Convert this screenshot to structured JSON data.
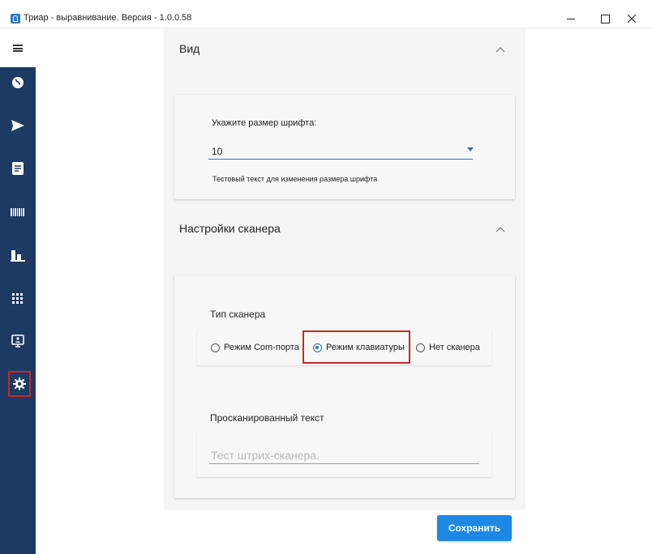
{
  "window": {
    "title": "Триар - выравнивание. Версия - 1.0.0.58"
  },
  "sidebar": {
    "items": [
      {
        "icon": "globe-icon"
      },
      {
        "icon": "send-icon"
      },
      {
        "icon": "document-icon"
      },
      {
        "icon": "barcode-icon"
      },
      {
        "icon": "bar-chart-icon"
      },
      {
        "icon": "grid-icon"
      },
      {
        "icon": "presentation-icon"
      },
      {
        "icon": "gear-icon",
        "active": true
      }
    ]
  },
  "view_section": {
    "title": "Вид",
    "font_size_label": "Укажите размер шрифта:",
    "font_size_value": "10",
    "sample_text": "Тестовый текст для изменения размера шрифта"
  },
  "scanner_section": {
    "title": "Настройки сканера",
    "scanner_type_label": "Тип сканера",
    "options": [
      {
        "label": "Режим Com-порта",
        "checked": false
      },
      {
        "label": "Режим клавиатуры",
        "checked": true
      },
      {
        "label": "Нет сканера",
        "checked": false
      }
    ],
    "scanned_text_label": "Просканированный текст",
    "scanned_text_placeholder": "Тест штрих-сканера."
  },
  "save_label": "Сохранить",
  "colors": {
    "sidebar": "#1d3a63",
    "accent": "#1e88e5",
    "highlight": "#c62828"
  }
}
